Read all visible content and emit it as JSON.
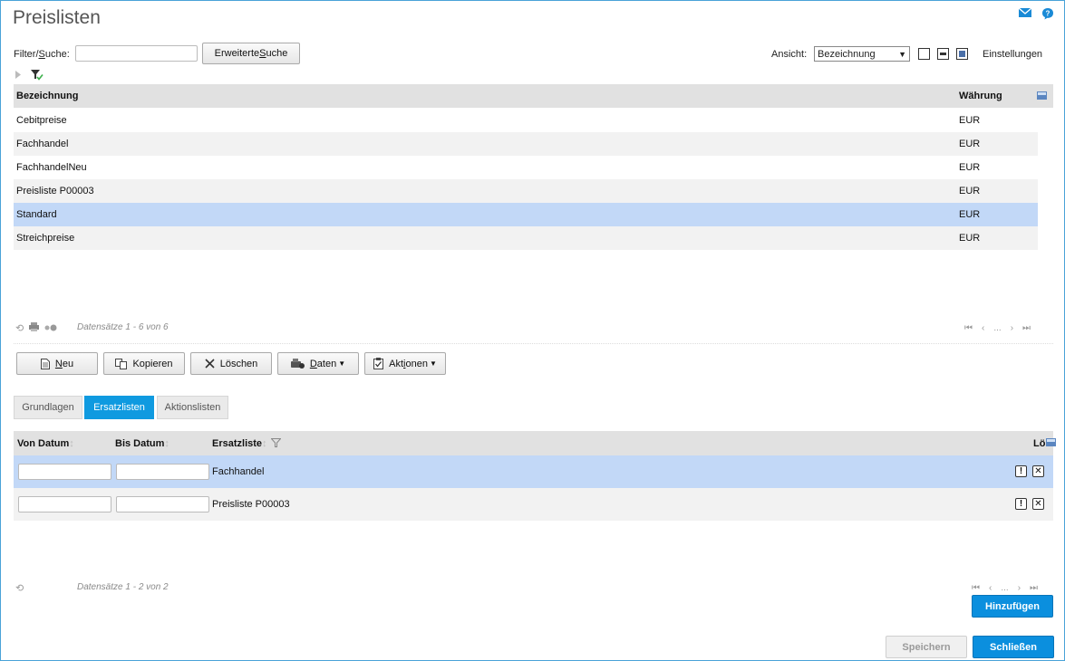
{
  "page": {
    "title": "Preislisten"
  },
  "filter": {
    "label_pre": "Filter/",
    "label_u": "S",
    "label_post": "uche:",
    "value": "",
    "advanced_pre": "Erweiterte ",
    "advanced_u": "S",
    "advanced_post": "uche"
  },
  "view": {
    "label": "Ansicht:",
    "selected": "Bezeichnung",
    "settings": "Einstellungen"
  },
  "main_grid": {
    "columns": [
      "Bezeichnung",
      "Währung"
    ],
    "rows": [
      {
        "name": "Cebitpreise",
        "currency": "EUR"
      },
      {
        "name": "Fachhandel",
        "currency": "EUR"
      },
      {
        "name": "FachhandelNeu",
        "currency": "EUR"
      },
      {
        "name": "Preisliste P00003",
        "currency": "EUR"
      },
      {
        "name": "Standard",
        "currency": "EUR"
      },
      {
        "name": "Streichpreise",
        "currency": "EUR"
      }
    ],
    "records": "Datensätze 1 - 6 von 6",
    "pager_dots": "..."
  },
  "toolbar": {
    "new_u": "N",
    "new_post": "eu",
    "copy": "Kopieren",
    "delete": "Löschen",
    "data_u": "D",
    "data_post": "aten",
    "actions_pre": "Akt",
    "actions_u": "i",
    "actions_post": "onen"
  },
  "tabs": [
    "Grundlagen",
    "Ersatzlisten",
    "Aktionslisten"
  ],
  "sub_grid": {
    "columns": [
      "Von Datum",
      "Bis Datum",
      "Ersatzliste",
      "Lö"
    ],
    "rows": [
      {
        "from": "",
        "to": "",
        "list": "Fachhandel"
      },
      {
        "from": "",
        "to": "",
        "list": "Preisliste P00003"
      }
    ],
    "records": "Datensätze 1 - 2 von 2",
    "pager_dots": "...",
    "info_btn": "!",
    "del_btn": "✕"
  },
  "buttons": {
    "add": "Hinzufügen",
    "save": "Speichern",
    "close": "Schließen"
  },
  "colors": {
    "accent": "#0b8fde",
    "selection": "#c2d8f7",
    "header_bg": "#e1e1e1"
  }
}
